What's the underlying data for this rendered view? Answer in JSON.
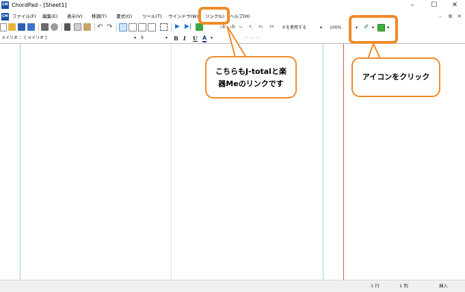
{
  "window": {
    "app_icon_text": "CM",
    "title": "ChordPad - [Sheet1]",
    "minimize": "–",
    "maximize": "☐",
    "close": "✕"
  },
  "menu": {
    "items": [
      "ファイル(F)",
      "編集(E)",
      "表示(V)",
      "移調(T)",
      "書式(O)",
      "ツール(T)",
      "ウインドウ(W)",
      "リンク(L)",
      "ヘルプ(H)"
    ],
    "mdi_minimize": "–",
    "mdi_restore": "⧉",
    "mdi_close": "✕"
  },
  "toolbar1": {
    "flat_mode": "＃を使用する",
    "zoom": "100%",
    "icons": [
      "new-icon",
      "open-icon",
      "save-icon",
      "save-all-icon",
      "print-icon",
      "preview-icon",
      "cut-icon",
      "copy-icon",
      "paste-icon",
      "undo-icon",
      "redo-icon",
      "layout1-icon",
      "layout2-icon",
      "layout3-icon",
      "layout4-icon",
      "fit-icon",
      "play-icon",
      "play-from-icon",
      "insert-icon",
      "chord1-icon",
      "chord2-icon",
      "chord3-icon",
      "chord4-icon",
      "chord5-icon",
      "chord6-icon",
      "link-icon",
      "instrument-icon"
    ]
  },
  "toolbar2": {
    "font_name": "メイリオ ： [ メイリオ ]",
    "font_size": "9",
    "bold": "B",
    "italic": "I",
    "underline": "U",
    "font_color": "A"
  },
  "statusbar": {
    "line": "1 行",
    "column": "1 列",
    "mode": "挿入"
  },
  "callouts": {
    "link_menu_note": "こちらもJ-totalと楽器Meのリンクです",
    "icon_note": "アイコンをクリック"
  },
  "colors": {
    "accent_orange": "#ef8a27",
    "margin_red": "#d9534f",
    "guide_blue": "#9ec9ea"
  }
}
